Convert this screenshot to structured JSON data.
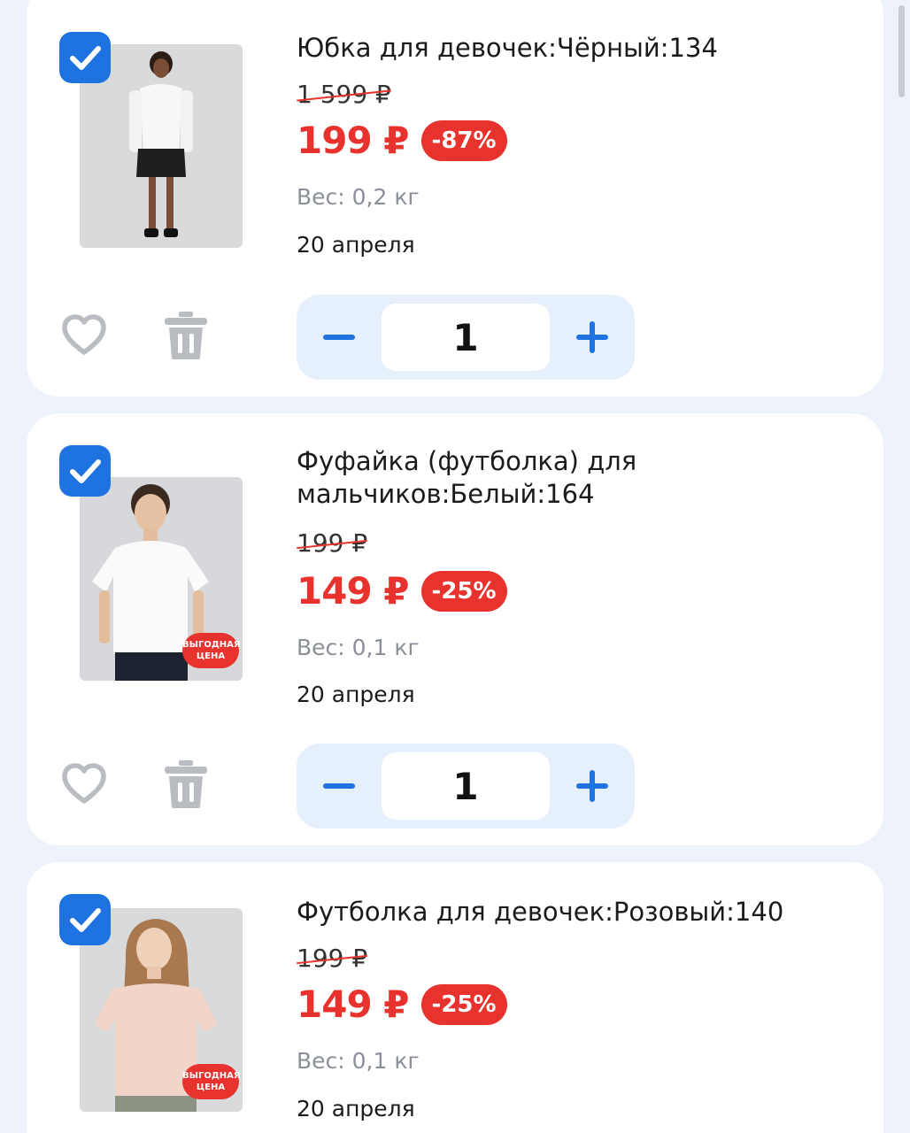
{
  "cart": {
    "items": [
      {
        "title": "Юбка для девочек:Чёрный:134",
        "old_price": "1 599 ₽",
        "price": "199 ₽",
        "discount": "-87%",
        "weight_label": "Вес:",
        "weight_value": "0,2 кг",
        "delivery": "20 апреля",
        "quantity": "1",
        "checked": true,
        "promo_badge": null
      },
      {
        "title": "Фуфайка (футболка) для мальчиков:Белый:164",
        "old_price": "199 ₽",
        "price": "149 ₽",
        "discount": "-25%",
        "weight_label": "Вес:",
        "weight_value": "0,1 кг",
        "delivery": "20 апреля",
        "quantity": "1",
        "checked": true,
        "promo_badge": "ВЫГОДНАЯ ЦЕНА"
      },
      {
        "title": "Футболка для девочек:Розовый:140",
        "old_price": "199 ₽",
        "price": "149 ₽",
        "discount": "-25%",
        "weight_label": "Вес:",
        "weight_value": "0,1 кг",
        "delivery": "20 апреля",
        "checked": true,
        "promo_badge": "ВЫГОДНАЯ ЦЕНА"
      }
    ]
  },
  "icons": {
    "checkbox": "checkmark-icon",
    "favorite": "heart-icon",
    "delete": "trash-icon",
    "decrease": "minus-icon",
    "increase": "plus-icon"
  },
  "colors": {
    "accent": "#1f73e0",
    "sale": "#e7322d",
    "background": "#eef3fb",
    "stepper_bg": "#e6f0fc",
    "muted": "#8a8f98"
  }
}
